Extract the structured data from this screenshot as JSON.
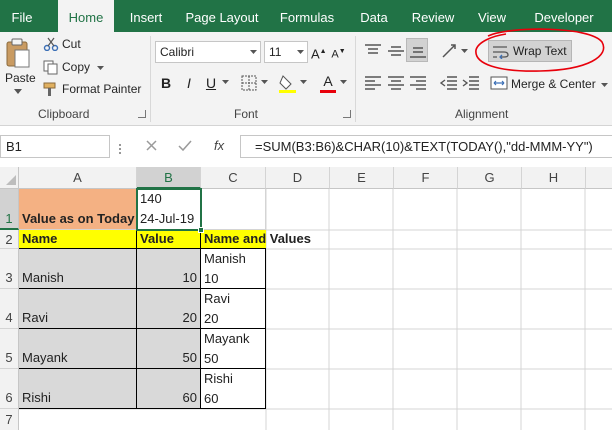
{
  "colors": {
    "accent": "#217346",
    "header_fill": "#f4b183",
    "yellow_fill": "#ffff00",
    "gray_fill": "#d9d9d9",
    "annotation": "#e8000b"
  },
  "tabs": [
    "File",
    "Home",
    "Insert",
    "Page Layout",
    "Formulas",
    "Data",
    "Review",
    "View",
    "Developer"
  ],
  "ribbon": {
    "clipboard": {
      "paste": "Paste",
      "cut": "Cut",
      "copy": "Copy",
      "format_painter": "Format Painter",
      "label": "Clipboard"
    },
    "font": {
      "name": "Calibri",
      "size": "11",
      "bold": "B",
      "italic": "I",
      "underline": "U",
      "label": "Font"
    },
    "alignment": {
      "wrap_text": "Wrap Text",
      "merge_center": "Merge & Center",
      "label": "Alignment"
    }
  },
  "formula_bar": {
    "name_box": "B1",
    "fx": "fx",
    "formula": "=SUM(B3:B6)&CHAR(10)&TEXT(TODAY(),\"dd-MMM-YY\")"
  },
  "sheet": {
    "columns": [
      "A",
      "B",
      "C",
      "D",
      "E",
      "F",
      "G",
      "H"
    ],
    "rows": [
      "1",
      "2",
      "3",
      "4",
      "5",
      "6",
      "7"
    ],
    "a1": "Value as on Today",
    "b1_line1": "140",
    "b1_line2": "24-Jul-19",
    "headers": {
      "a2": "Name",
      "b2": "Value",
      "c2": "Name and Values"
    },
    "records": [
      {
        "name": "Manish",
        "value": "10",
        "combo_name": "Manish",
        "combo_value": "10"
      },
      {
        "name": "Ravi",
        "value": "20",
        "combo_name": "Ravi",
        "combo_value": "20"
      },
      {
        "name": "Mayank",
        "value": "50",
        "combo_name": "Mayank",
        "combo_value": "50"
      },
      {
        "name": "Rishi",
        "value": "60",
        "combo_name": "Rishi",
        "combo_value": "60"
      }
    ]
  }
}
